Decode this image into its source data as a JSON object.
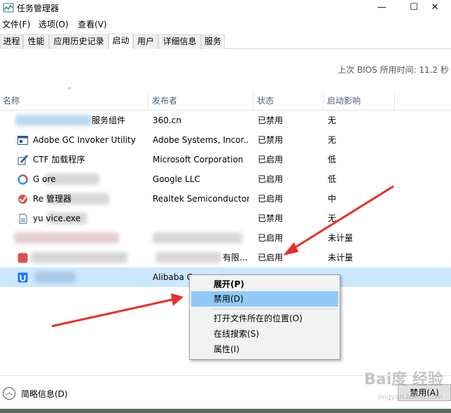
{
  "window": {
    "title": "任务管理器",
    "minimize": "—",
    "maximize": "☐",
    "close": "✕"
  },
  "menu": [
    "文件(F)",
    "选项(O)",
    "查看(V)"
  ],
  "tabs": [
    "进程",
    "性能",
    "应用历史记录",
    "启动",
    "用户",
    "详细信息",
    "服务"
  ],
  "active_tab": "启动",
  "bios": {
    "label": "上次 BIOS 所用时间:    11.2 秒"
  },
  "columns": {
    "name": "名称",
    "publisher": "发布者",
    "status": "状态",
    "impact": "启动影响"
  },
  "rows": [
    {
      "name": "服务组件",
      "publisher": "360.cn",
      "status": "已禁用",
      "impact": "无",
      "icon": "blurred-icon"
    },
    {
      "name": "Adobe GC Invoker Utility",
      "publisher": "Adobe Systems, Incor...",
      "status": "已禁用",
      "impact": "无",
      "icon": "adobe-app-icon"
    },
    {
      "name": "CTF 加载程序",
      "publisher": "Microsoft Corporation",
      "status": "已启用",
      "impact": "低",
      "icon": "ctf-pen-icon"
    },
    {
      "name": "G            ore",
      "publisher": "Google LLC",
      "status": "已启用",
      "impact": "低",
      "icon": "google-icon"
    },
    {
      "name": "Re                管理器",
      "publisher": "Realtek Semiconductor",
      "status": "已启用",
      "impact": "中",
      "icon": "realtek-icon"
    },
    {
      "name": "yu         vice.exe",
      "publisher": "",
      "status": "已禁用",
      "impact": "无",
      "icon": "exe-file-icon"
    },
    {
      "name": "",
      "publisher": "",
      "status": "已启用",
      "impact": "未计量",
      "icon": "blurred-icon"
    },
    {
      "name": "",
      "publisher": "有限...",
      "status": "已启用",
      "impact": "未计量",
      "icon": "red-app-icon"
    },
    {
      "name": "",
      "publisher": "Alibaba C",
      "status": "",
      "impact": "",
      "icon": "alibaba-app-icon"
    }
  ],
  "context_menu": {
    "items": [
      "展开(P)",
      "禁用(D)",
      "打开文件所在的位置(O)",
      "在线搜索(S)",
      "属性(I)"
    ]
  },
  "footer": {
    "fewer_details": "简略信息(D)",
    "disable_button": "禁用(A)"
  },
  "watermark": {
    "brand": "Bai度 经验",
    "url": "jingyan.baidu.com"
  },
  "colors": {
    "selected_row": "#cce8ff",
    "menu_highlight": "#91c9f7",
    "arrow": "#e8302a",
    "header_text": "#4c607a"
  }
}
